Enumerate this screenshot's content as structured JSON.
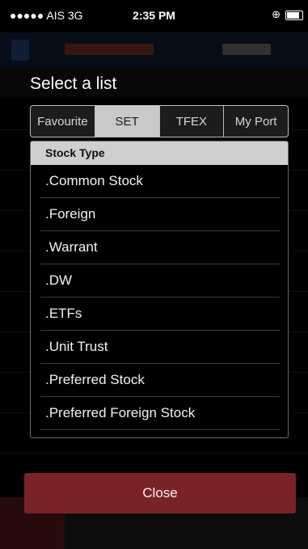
{
  "status_bar": {
    "carrier": "●●●●● AIS  3G",
    "time": "2:35 PM"
  },
  "dialog": {
    "title": "Select a list",
    "tabs": [
      {
        "label": "Favourite",
        "selected": false
      },
      {
        "label": "SET",
        "selected": true
      },
      {
        "label": "TFEX",
        "selected": false
      },
      {
        "label": "My Port",
        "selected": false
      }
    ],
    "section_header": "Stock Type",
    "items": [
      ".Common Stock",
      ".Foreign",
      ".Warrant",
      ".DW",
      ".ETFs",
      ".Unit Trust",
      ".Preferred Stock",
      ".Preferred Foreign Stock"
    ],
    "close_label": "Close"
  },
  "colors": {
    "close_button": "#7a2326",
    "selected_tab": "#c9c9c9",
    "section_header": "#cfcfcf",
    "background": "#000000"
  }
}
